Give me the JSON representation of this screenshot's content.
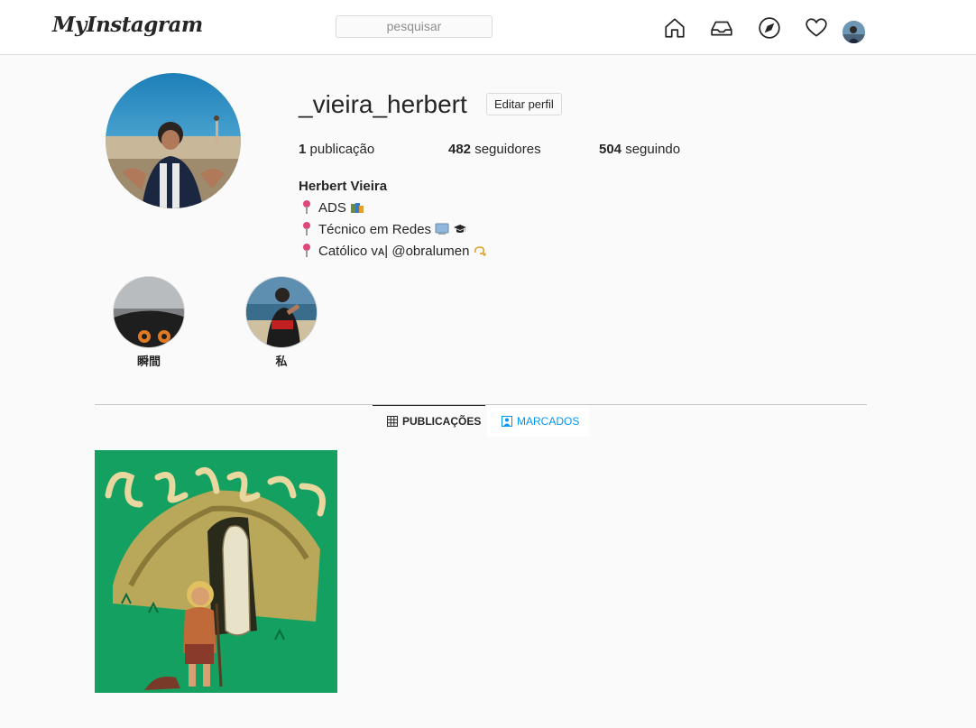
{
  "header": {
    "logo": "MyInstagram",
    "search_placeholder": "pesquisar",
    "icons": [
      "home-icon",
      "inbox-icon",
      "explore-icon",
      "heart-icon"
    ]
  },
  "profile": {
    "username": "_vieira_herbert",
    "edit_label": "Editar perfil",
    "stats": {
      "posts_count": "1",
      "posts_label": "publicação",
      "followers_count": "482",
      "followers_label": "seguidores",
      "following_count": "504",
      "following_label": "seguindo"
    },
    "full_name": "Herbert Vieira",
    "bio": [
      "ADS",
      "Técnico em Redes",
      "Católico ᴠᴀ| @obralumen"
    ]
  },
  "highlights": [
    {
      "label": "瞬間"
    },
    {
      "label": "私"
    }
  ],
  "tabs": {
    "posts": "PUBLICAÇÕES",
    "tagged": "MARCADOS"
  },
  "colors": {
    "accent": "#0095f6",
    "post_bg": "#13a060",
    "pin": "#e0477a"
  }
}
